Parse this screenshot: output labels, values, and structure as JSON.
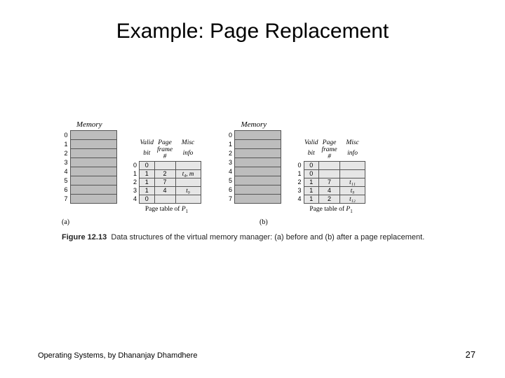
{
  "title": "Example: Page Replacement",
  "memory": {
    "heading": "Memory",
    "rows": [
      0,
      1,
      2,
      3,
      4,
      5,
      6,
      7
    ]
  },
  "pagetable": {
    "headers": {
      "valid": "Valid\nbit",
      "frame": "Page\nframe #",
      "misc": "Misc\ninfo"
    },
    "captionPrefix": "Page table of ",
    "proc": "P",
    "procSub": "1"
  },
  "panelA": {
    "label": "(a)",
    "rows": [
      {
        "i": 0,
        "v": "0",
        "f": "",
        "m": ""
      },
      {
        "i": 1,
        "v": "1",
        "f": "2",
        "m": "t₄, m"
      },
      {
        "i": 2,
        "v": "1",
        "f": "7",
        "m": ""
      },
      {
        "i": 3,
        "v": "1",
        "f": "4",
        "m": "t₉"
      },
      {
        "i": 4,
        "v": "0",
        "f": "",
        "m": ""
      }
    ]
  },
  "panelB": {
    "label": "(b)",
    "rows": [
      {
        "i": 0,
        "v": "0",
        "f": "",
        "m": ""
      },
      {
        "i": 1,
        "v": "0",
        "f": "",
        "m": ""
      },
      {
        "i": 2,
        "v": "1",
        "f": "7",
        "m": "t₁₁"
      },
      {
        "i": 3,
        "v": "1",
        "f": "4",
        "m": "t₉"
      },
      {
        "i": 4,
        "v": "1",
        "f": "2",
        "m": "t₁₂"
      }
    ]
  },
  "figcaption": {
    "label": "Figure 12.13",
    "text": "Data structures of the virtual memory manager: (a) before and (b) after a page replacement."
  },
  "footer": {
    "left": "Operating Systems, by Dhananjay Dhamdhere",
    "right": "27"
  }
}
